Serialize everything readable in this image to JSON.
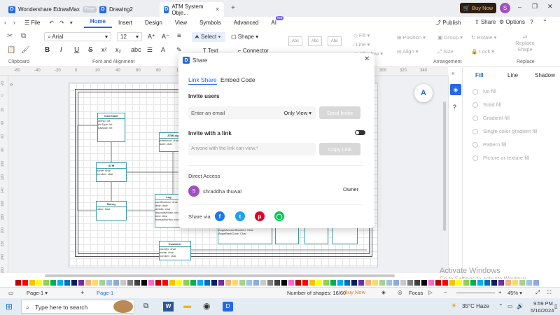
{
  "titlebar": {
    "tabs": [
      {
        "label": "Wondershare EdrawMax",
        "badge": "Free"
      },
      {
        "label": "Drawing2"
      },
      {
        "label": "ATM System Obje..."
      }
    ],
    "buy_now": "Buy Now",
    "avatar_letter": "S"
  },
  "menubar": {
    "file": "File",
    "items": [
      "Home",
      "Insert",
      "Design",
      "View",
      "Symbols",
      "Advanced",
      "AI"
    ],
    "ai_badge": "hot",
    "publish": "Publish",
    "share": "Share",
    "options": "Options"
  },
  "ribbon": {
    "font_name": "Arial",
    "font_size": "12",
    "select": "Select",
    "shape": "Shape",
    "text": "Text",
    "connector": "Connector",
    "style_sample": "Abc",
    "fill": "Fill",
    "line": "Line",
    "shadow": "Shadow",
    "position": "Position",
    "group": "Group",
    "rotate": "Rotate",
    "replace_shape": "Replace Shape",
    "align": "Align",
    "size": "Size",
    "lock": "Lock",
    "groups": {
      "clipboard": "Clipboard",
      "font": "Font and Alignment",
      "arrangement": "Arrangement",
      "replace": "Replace"
    }
  },
  "ruler": {
    "top": [
      "-60",
      "-40",
      "-20",
      "0",
      "20",
      "40",
      "60",
      "80",
      "100",
      "120",
      "140",
      "160",
      "180",
      "200",
      "220",
      "240",
      "260",
      "280",
      "300",
      "320",
      "340"
    ],
    "left": [
      "-20",
      "0",
      "20",
      "40",
      "60",
      "80",
      "100",
      "120",
      "140",
      "160",
      "180",
      "200",
      "220",
      "240",
      "260"
    ]
  },
  "diagram": {
    "boxes": [
      {
        "title": "InnerCash",
        "lines": [
          "pinNo: int",
          "pinType: int",
          "balance: int"
        ]
      },
      {
        "title": "ATM",
        "lines": [
          "name: char",
          "number: char"
        ]
      },
      {
        "title": "Money",
        "lines": [
          "value: float"
        ]
      },
      {
        "title": "ATMLog",
        "lines": [
          "password: char",
          "date: char"
        ]
      },
      {
        "title": "Log",
        "lines": [
          "cardNumber: char",
          "date: date",
          "details: char",
          "depositMoney: char",
          "time: time",
          "transactionNo: char"
        ]
      },
      {
        "title": "Customer",
        "lines": [
          "country: char",
          "name: char",
          "number: char"
        ]
      }
    ],
    "footer_lines": [
      "AngelAccountNumber: Char",
      "AngelBankCode: Char"
    ]
  },
  "right_panel": {
    "tabs": [
      "Fill",
      "Line",
      "Shadow"
    ],
    "options": [
      "No fill",
      "Solid fill",
      "Gradient fill",
      "Single color gradient fill",
      "Pattern fill",
      "Picture or texture fill"
    ]
  },
  "dialog": {
    "title": "Share",
    "tabs": [
      "Link Share",
      "Embed Code"
    ],
    "invite_users": "Invite users",
    "email_placeholder": "Enter an email",
    "permission": "Only View",
    "send_invite": "Send Invite",
    "invite_link": "Invite with a link",
    "link_placeholder": "Anyone with the link can view.*",
    "copy_link": "Copy Link",
    "direct_access": "Direct Access",
    "user_letter": "S",
    "user_name": "shraddha thuwal",
    "owner": "Owner",
    "share_via": "Share via"
  },
  "statusbar": {
    "page_select": "Page-1",
    "page_tab": "Page-1",
    "shapes": "Number of shapes: 16/60",
    "buy_now": "Buy Now",
    "focus": "Focus",
    "zoom": "45%"
  },
  "watermark": {
    "line1": "Activate Windows",
    "line2": "Go to Settings to activate Windows."
  },
  "taskbar": {
    "search": "Type here to search",
    "temp": "35°C",
    "weather": "Haze",
    "time": "9:59 PM",
    "date": "5/16/2024"
  },
  "colors": {
    "accent": "#2468e8",
    "buy_now_bg": "#2d1f12",
    "buy_now_text": "#f0c060",
    "uml_border": "#3aa0a8"
  }
}
